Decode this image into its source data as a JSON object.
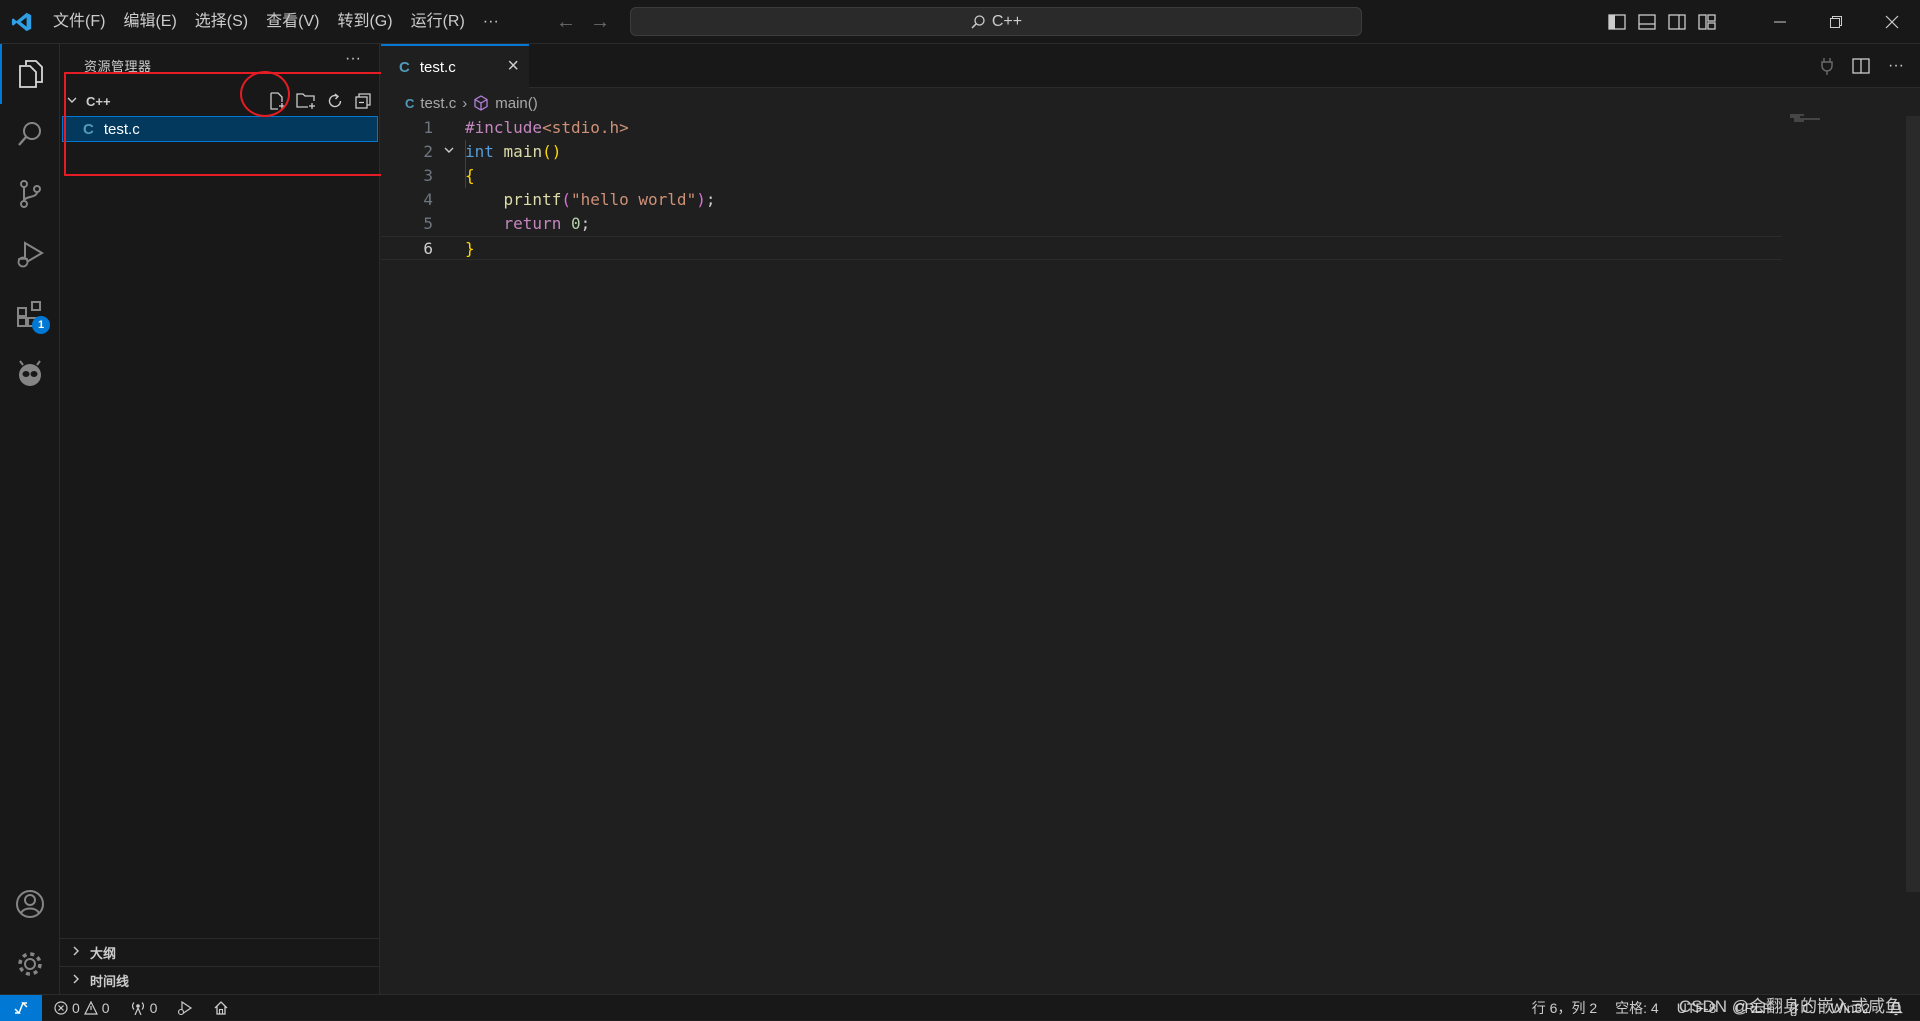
{
  "titlebar": {
    "menu": [
      "文件(F)",
      "编辑(E)",
      "选择(S)",
      "查看(V)",
      "转到(G)",
      "运行(R)",
      "···"
    ],
    "search_text": "C++"
  },
  "activitybar": {
    "extensions_badge": "1"
  },
  "sidebar": {
    "title": "资源管理器",
    "more": "···",
    "folder_name": "C++",
    "file_icon": "C",
    "file_name": "test.c",
    "panels": [
      "大纲",
      "时间线"
    ]
  },
  "editor": {
    "tab_icon": "C",
    "tab_name": "test.c",
    "breadcrumb_file": "test.c",
    "breadcrumb_symbol": "main()",
    "line_numbers": [
      "1",
      "2",
      "3",
      "4",
      "5",
      "6"
    ]
  },
  "statusbar": {
    "errors": "0",
    "warnings": "0",
    "ports": "0",
    "position": "行 6，列 2",
    "spaces": "空格: 4",
    "encoding": "UTF-8",
    "eol": "CRLF",
    "language": "{} C",
    "platform": "Win32"
  },
  "watermark": "CSDN @会翻身的嵌入式咸鱼",
  "colors": {
    "accent": "#0078d4",
    "annotation": "#e51c23"
  }
}
